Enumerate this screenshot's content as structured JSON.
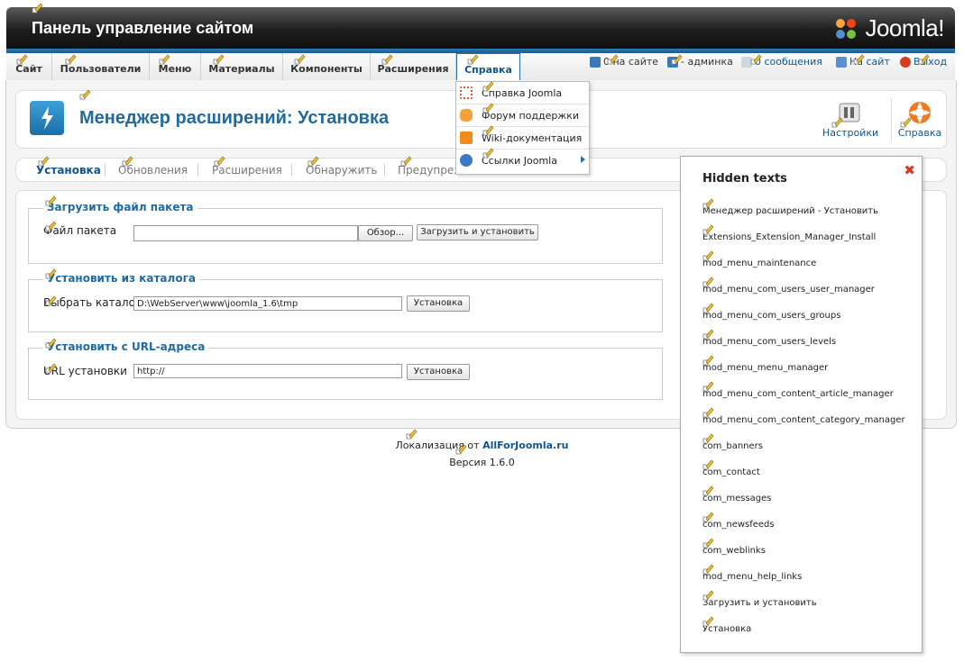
{
  "header": {
    "title": "Панель управление сайтом",
    "logo_text": "Joomla!"
  },
  "menu": [
    {
      "label": "Сайт"
    },
    {
      "label": "Пользователи"
    },
    {
      "label": "Меню"
    },
    {
      "label": "Материалы"
    },
    {
      "label": "Компоненты"
    },
    {
      "label": "Расширения"
    },
    {
      "label": "Справка",
      "active": true
    }
  ],
  "status": {
    "online": "0 на сайте",
    "admins": "- админка",
    "messages": "0 сообщения",
    "view_site": "На сайт",
    "logout": "Выход"
  },
  "dropdown": {
    "items": [
      {
        "label": "Справка Joomla",
        "icon": "joomla-help-icon"
      },
      {
        "label": "Форум поддержки",
        "icon": "forum-icon"
      },
      {
        "label": "Wiki-документация",
        "icon": "wiki-icon"
      },
      {
        "label": "Ссылки Joomla",
        "icon": "links-icon",
        "submenu": true
      }
    ]
  },
  "toolbar": {
    "title": "Менеджер расширений: Установка",
    "settings_label": "Настройки",
    "help_label": "Справка"
  },
  "tabs": [
    "Установка",
    "Обновления",
    "Расширения",
    "Обнаружить",
    "Предупреж"
  ],
  "upload": {
    "legend": "Загрузить файл пакета",
    "label": "Файл пакета",
    "browse": "Обзор...",
    "button": "Загрузить и установить"
  },
  "directory": {
    "legend": "Установить из каталога",
    "label": "Выбрать каталог",
    "value": "D:\\WebServer\\www\\joomla_1.6\\tmp",
    "button": "Установка"
  },
  "url": {
    "legend": "Установить с URL-адреса",
    "label": "URL установки",
    "value": "http://",
    "button": "Установка"
  },
  "footer": {
    "localization_prefix": "Локализация от",
    "localization_link": "AllForJoomla.ru",
    "version": "Версия 1.6.0"
  },
  "hidden_texts": {
    "title": "Hidden texts",
    "items": [
      "Менеджер расширений - Установить",
      "Extensions_Extension_Manager_Install",
      "mod_menu_maintenance",
      "mod_menu_com_users_user_manager",
      "mod_menu_com_users_groups",
      "mod_menu_com_users_levels",
      "mod_menu_menu_manager",
      "mod_menu_com_content_article_manager",
      "mod_menu_com_content_category_manager",
      "com_banners",
      "com_contact",
      "com_messages",
      "com_newsfeeds",
      "com_weblinks",
      "mod_menu_help_links",
      "Загрузить и установить",
      "Установка"
    ]
  },
  "colors": {
    "accent": "#1f6aa0",
    "link": "#10568c",
    "header": "#1e1e1e",
    "close": "#d93a1e"
  }
}
